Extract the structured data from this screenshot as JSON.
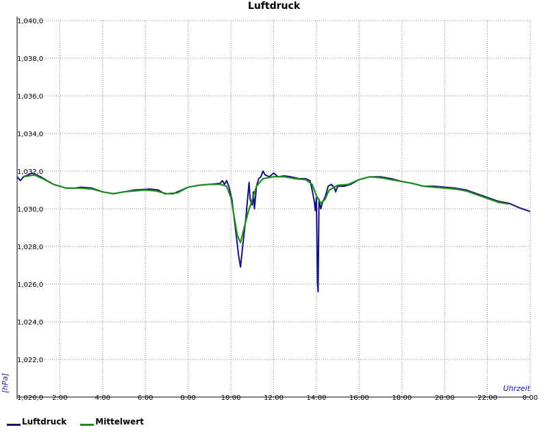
{
  "colors": {
    "series_raw": "#14147a",
    "series_mean": "#1e8c1e",
    "grid": "#888888",
    "axis_label": "#1a1ab0"
  },
  "chart_data": {
    "type": "line",
    "title": "Luftdruck",
    "xlabel": "Uhrzeit",
    "ylabel": "[hPa]",
    "xlim": [
      0,
      24
    ],
    "ylim": [
      1020.0,
      1040.0
    ],
    "grid": true,
    "legend_position": "bottom-left",
    "x_ticks": [
      "2:00",
      "4:00",
      "6:00",
      "8:00",
      "10:00",
      "12:00",
      "14:00",
      "16:00",
      "18:00",
      "20:00",
      "22:00",
      "0:00"
    ],
    "y_ticks": [
      "1,020,0",
      "1,022,0",
      "1,024,0",
      "1,026,0",
      "1,028,0",
      "1,030,0",
      "1,032,0",
      "1,034,0",
      "1,036,0",
      "1,038,0",
      "1,040,0"
    ],
    "series": [
      {
        "name": "Luftdruck",
        "points": [
          [
            0.0,
            1031.7
          ],
          [
            0.15,
            1031.5
          ],
          [
            0.3,
            1031.7
          ],
          [
            0.5,
            1031.8
          ],
          [
            0.7,
            1031.9
          ],
          [
            0.9,
            1031.8
          ],
          [
            1.1,
            1031.7
          ],
          [
            1.4,
            1031.5
          ],
          [
            1.7,
            1031.3
          ],
          [
            2.0,
            1031.2
          ],
          [
            2.3,
            1031.1
          ],
          [
            2.7,
            1031.1
          ],
          [
            3.0,
            1031.15
          ],
          [
            3.5,
            1031.1
          ],
          [
            4.0,
            1030.9
          ],
          [
            4.5,
            1030.8
          ],
          [
            5.0,
            1030.9
          ],
          [
            5.5,
            1031.0
          ],
          [
            6.2,
            1031.05
          ],
          [
            6.6,
            1031.0
          ],
          [
            6.9,
            1030.8
          ],
          [
            7.3,
            1030.8
          ],
          [
            7.7,
            1031.0
          ],
          [
            8.0,
            1031.15
          ],
          [
            8.5,
            1031.25
          ],
          [
            9.0,
            1031.3
          ],
          [
            9.5,
            1031.35
          ],
          [
            9.6,
            1031.5
          ],
          [
            9.7,
            1031.3
          ],
          [
            9.8,
            1031.5
          ],
          [
            9.9,
            1031.2
          ],
          [
            10.05,
            1030.5
          ],
          [
            10.15,
            1029.5
          ],
          [
            10.25,
            1028.6
          ],
          [
            10.35,
            1027.6
          ],
          [
            10.45,
            1026.9
          ],
          [
            10.55,
            1028.0
          ],
          [
            10.7,
            1029.5
          ],
          [
            10.8,
            1030.8
          ],
          [
            10.85,
            1031.4
          ],
          [
            10.9,
            1030.5
          ],
          [
            11.0,
            1030.2
          ],
          [
            11.05,
            1030.9
          ],
          [
            11.1,
            1030.0
          ],
          [
            11.2,
            1031.2
          ],
          [
            11.3,
            1031.6
          ],
          [
            11.4,
            1031.7
          ],
          [
            11.5,
            1032.0
          ],
          [
            11.6,
            1031.8
          ],
          [
            11.8,
            1031.7
          ],
          [
            12.0,
            1031.9
          ],
          [
            12.2,
            1031.7
          ],
          [
            12.5,
            1031.75
          ],
          [
            12.8,
            1031.7
          ],
          [
            13.2,
            1031.6
          ],
          [
            13.5,
            1031.6
          ],
          [
            13.7,
            1031.5
          ],
          [
            13.8,
            1031.0
          ],
          [
            13.9,
            1030.4
          ],
          [
            13.95,
            1029.9
          ],
          [
            14.0,
            1030.6
          ],
          [
            14.05,
            1026.1
          ],
          [
            14.08,
            1025.6
          ],
          [
            14.12,
            1030.5
          ],
          [
            14.2,
            1030.0
          ],
          [
            14.3,
            1030.4
          ],
          [
            14.4,
            1030.6
          ],
          [
            14.55,
            1031.2
          ],
          [
            14.7,
            1031.3
          ],
          [
            14.85,
            1031.1
          ],
          [
            14.9,
            1030.9
          ],
          [
            15.0,
            1031.2
          ],
          [
            15.3,
            1031.2
          ],
          [
            15.6,
            1031.3
          ],
          [
            16.0,
            1031.55
          ],
          [
            16.5,
            1031.7
          ],
          [
            17.0,
            1031.7
          ],
          [
            17.5,
            1031.6
          ],
          [
            18.0,
            1031.45
          ],
          [
            18.5,
            1031.35
          ],
          [
            19.0,
            1031.2
          ],
          [
            19.5,
            1031.2
          ],
          [
            20.0,
            1031.15
          ],
          [
            20.5,
            1031.1
          ],
          [
            21.0,
            1031.0
          ],
          [
            21.5,
            1030.8
          ],
          [
            22.0,
            1030.6
          ],
          [
            22.5,
            1030.4
          ],
          [
            23.0,
            1030.3
          ],
          [
            23.5,
            1030.05
          ],
          [
            24.0,
            1029.85
          ]
        ]
      },
      {
        "name": "Mittelwert",
        "points": [
          [
            0.3,
            1031.7
          ],
          [
            0.8,
            1031.8
          ],
          [
            1.2,
            1031.6
          ],
          [
            1.7,
            1031.3
          ],
          [
            2.3,
            1031.1
          ],
          [
            3.0,
            1031.1
          ],
          [
            3.5,
            1031.05
          ],
          [
            4.0,
            1030.9
          ],
          [
            4.5,
            1030.8
          ],
          [
            5.0,
            1030.9
          ],
          [
            6.0,
            1031.0
          ],
          [
            6.5,
            1030.95
          ],
          [
            7.0,
            1030.8
          ],
          [
            7.5,
            1030.85
          ],
          [
            8.0,
            1031.15
          ],
          [
            8.5,
            1031.25
          ],
          [
            9.0,
            1031.3
          ],
          [
            9.5,
            1031.3
          ],
          [
            9.8,
            1031.2
          ],
          [
            10.0,
            1030.6
          ],
          [
            10.15,
            1029.6
          ],
          [
            10.3,
            1028.6
          ],
          [
            10.45,
            1028.2
          ],
          [
            10.6,
            1028.9
          ],
          [
            10.8,
            1029.8
          ],
          [
            11.0,
            1030.5
          ],
          [
            11.2,
            1031.2
          ],
          [
            11.5,
            1031.6
          ],
          [
            12.0,
            1031.7
          ],
          [
            12.5,
            1031.7
          ],
          [
            13.0,
            1031.6
          ],
          [
            13.5,
            1031.55
          ],
          [
            13.8,
            1031.3
          ],
          [
            14.0,
            1030.7
          ],
          [
            14.2,
            1030.3
          ],
          [
            14.4,
            1030.5
          ],
          [
            14.6,
            1031.0
          ],
          [
            15.0,
            1031.25
          ],
          [
            15.5,
            1031.3
          ],
          [
            16.0,
            1031.55
          ],
          [
            16.5,
            1031.7
          ],
          [
            17.0,
            1031.65
          ],
          [
            17.5,
            1031.55
          ],
          [
            18.0,
            1031.45
          ],
          [
            18.5,
            1031.35
          ],
          [
            19.0,
            1031.2
          ],
          [
            19.5,
            1031.15
          ],
          [
            20.0,
            1031.1
          ],
          [
            20.5,
            1031.05
          ],
          [
            21.0,
            1030.95
          ],
          [
            21.5,
            1030.75
          ],
          [
            22.0,
            1030.55
          ],
          [
            22.5,
            1030.35
          ],
          [
            23.0,
            1030.25
          ]
        ]
      }
    ]
  }
}
